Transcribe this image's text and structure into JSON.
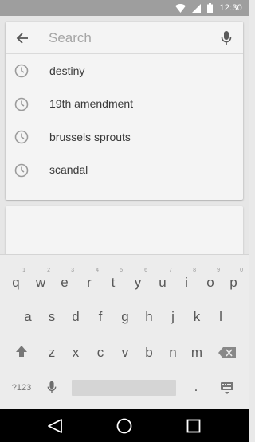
{
  "status_bar": {
    "time": "12:30",
    "icons": [
      "wifi-icon",
      "signal-icon",
      "battery-icon"
    ]
  },
  "search": {
    "placeholder": "Search",
    "value": ""
  },
  "history": [
    {
      "label": "destiny",
      "icon": "clock-icon"
    },
    {
      "label": "19th amendment",
      "icon": "clock-icon"
    },
    {
      "label": "brussels sprouts",
      "icon": "clock-icon"
    },
    {
      "label": "scandal",
      "icon": "clock-icon"
    }
  ],
  "keyboard": {
    "row1": [
      {
        "key": "q",
        "hint": "1"
      },
      {
        "key": "w",
        "hint": "2"
      },
      {
        "key": "e",
        "hint": "3"
      },
      {
        "key": "r",
        "hint": "4"
      },
      {
        "key": "t",
        "hint": "5"
      },
      {
        "key": "y",
        "hint": "6"
      },
      {
        "key": "u",
        "hint": "7"
      },
      {
        "key": "i",
        "hint": "8"
      },
      {
        "key": "o",
        "hint": "9"
      },
      {
        "key": "p",
        "hint": "0"
      }
    ],
    "row2": [
      "a",
      "s",
      "d",
      "f",
      "g",
      "h",
      "j",
      "k",
      "l"
    ],
    "row3": [
      "z",
      "x",
      "c",
      "v",
      "b",
      "n",
      "m"
    ],
    "symbols_label": "?123",
    "period_label": "."
  },
  "colors": {
    "status_bar": "#9e9e9e",
    "card": "#f4f4f4",
    "keyboard": "#ececec",
    "nav_bar": "#000000"
  }
}
